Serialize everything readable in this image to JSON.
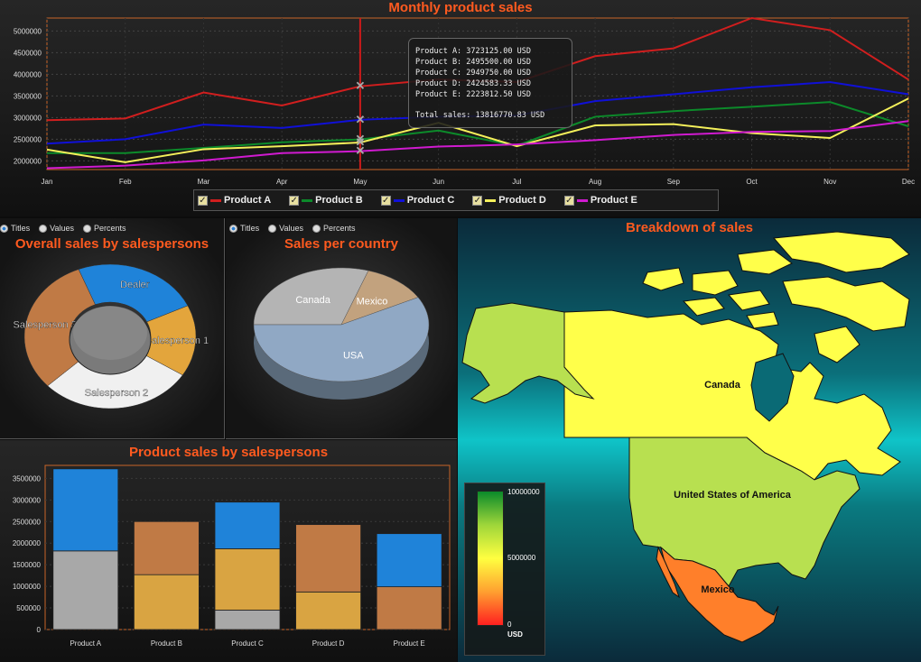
{
  "colors": {
    "title": "#ff5a1f",
    "productA": "#d11e1e",
    "productB": "#0c8a2a",
    "productC": "#1010d8",
    "productD": "#f4f05a",
    "productE": "#d01ad0"
  },
  "line_chart": {
    "title": "Monthly product sales",
    "tooltip": {
      "lines": [
        "Product A: 3723125.00 USD",
        "Product B: 2495500.00 USD",
        "Product C: 2949750.00 USD",
        "Product D: 2424583.33 USD",
        "Product E: 2223812.50 USD"
      ],
      "total": "Total sales: 13816770.83 USD"
    },
    "legend": [
      "Product A",
      "Product B",
      "Product C",
      "Product D",
      "Product E"
    ]
  },
  "donut_panel": {
    "title": "Overall sales by salespersons",
    "radios": [
      "Titles",
      "Values",
      "Percents"
    ]
  },
  "pie_panel": {
    "title": "Sales per country",
    "radios": [
      "Titles",
      "Values",
      "Percents"
    ]
  },
  "bar_panel": {
    "title": "Product sales by salespersons"
  },
  "map_panel": {
    "title": "Breakdown of sales",
    "countries": [
      "Canada",
      "United States of America",
      "Mexico"
    ],
    "scale": {
      "max": "10000000",
      "mid": "5000000",
      "min": "0",
      "unit": "USD"
    }
  },
  "chart_data": [
    {
      "type": "line",
      "title": "Monthly product sales",
      "x": [
        "Jan",
        "Feb",
        "Mar",
        "Apr",
        "May",
        "Jun",
        "Jul",
        "Aug",
        "Sep",
        "Oct",
        "Nov",
        "Dec"
      ],
      "ylim": [
        1800000,
        5300000
      ],
      "yticks": [
        2000000,
        2500000,
        3000000,
        3500000,
        4000000,
        4500000,
        5000000
      ],
      "series": [
        {
          "name": "Product A",
          "color": "#d11e1e",
          "values": [
            2940000,
            2980000,
            3580000,
            3280000,
            3723125,
            3880000,
            3820000,
            4420000,
            4600000,
            5300000,
            5020000,
            3880000
          ]
        },
        {
          "name": "Product B",
          "color": "#0c8a2a",
          "values": [
            2180000,
            2180000,
            2300000,
            2430000,
            2495500,
            2700000,
            2350000,
            3020000,
            3150000,
            3250000,
            3360000,
            2800000
          ]
        },
        {
          "name": "Product C",
          "color": "#1010d8",
          "values": [
            2400000,
            2500000,
            2840000,
            2760000,
            2949750,
            3020000,
            3050000,
            3380000,
            3540000,
            3700000,
            3820000,
            3540000
          ]
        },
        {
          "name": "Product D",
          "color": "#f4f05a",
          "values": [
            2260000,
            1970000,
            2270000,
            2340000,
            2424583,
            2880000,
            2340000,
            2820000,
            2850000,
            2640000,
            2530000,
            3440000
          ]
        },
        {
          "name": "Product E",
          "color": "#d01ad0",
          "values": [
            1830000,
            1890000,
            2010000,
            2180000,
            2223812,
            2330000,
            2380000,
            2480000,
            2600000,
            2670000,
            2690000,
            2920000
          ]
        }
      ]
    },
    {
      "type": "pie",
      "title": "Overall sales by salespersons",
      "slices": [
        {
          "label": "Dealer",
          "value": 24,
          "color": "#1f83d9"
        },
        {
          "label": "Salesperson 1",
          "value": 16,
          "color": "#e3a53c"
        },
        {
          "label": "Salesperson 2",
          "value": 29,
          "color": "#f0f0f0"
        },
        {
          "label": "Salesperson 3",
          "value": 31,
          "color": "#c07a45"
        }
      ]
    },
    {
      "type": "pie",
      "title": "Sales per country",
      "slices": [
        {
          "label": "Canada",
          "value": 30,
          "color": "#b4b4b4"
        },
        {
          "label": "Mexico",
          "value": 12,
          "color": "#c2a27e"
        },
        {
          "label": "USA",
          "value": 58,
          "color": "#90a8c4"
        }
      ]
    },
    {
      "type": "bar",
      "title": "Product sales by salespersons",
      "categories": [
        "Product A",
        "Product B",
        "Product C",
        "Product D",
        "Product E"
      ],
      "ylim": [
        0,
        3800000
      ],
      "yticks": [
        0,
        500000,
        1000000,
        1500000,
        2000000,
        2500000,
        3000000,
        3500000
      ],
      "series": [
        {
          "name": "Salesperson 2",
          "color": "#a8a8a8",
          "values": [
            1820000,
            0,
            450000,
            0,
            0
          ]
        },
        {
          "name": "Salesperson 1",
          "color": "#d9a442",
          "values": [
            0,
            1270000,
            1420000,
            870000,
            0
          ]
        },
        {
          "name": "Salesperson 3",
          "color": "#c07a45",
          "values": [
            0,
            1230000,
            0,
            1560000,
            990000
          ]
        },
        {
          "name": "Dealer",
          "color": "#1f83d9",
          "values": [
            1900000,
            0,
            1080000,
            0,
            1230000
          ]
        }
      ]
    }
  ]
}
